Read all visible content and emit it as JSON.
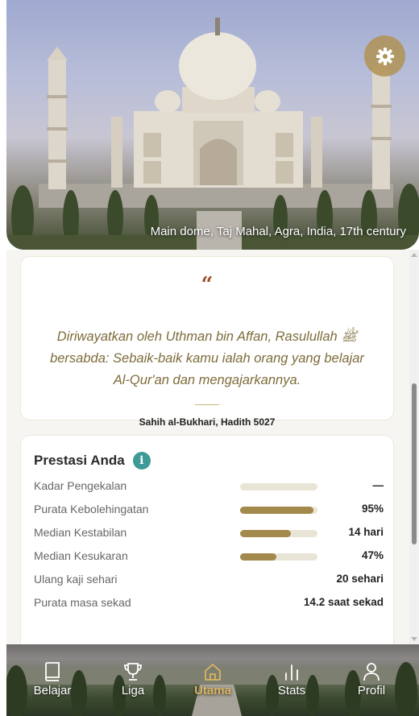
{
  "hero": {
    "caption": "Main dome, Taj Mahal, Agra, India, 17th century",
    "settings_icon": "gear-icon"
  },
  "quote": {
    "mark": "“",
    "text": "Diriwayatkan oleh Uthman bin Affan, Rasulullah ﷺ bersabda: Sebaik-baik kamu ialah orang yang belajar Al-Qur'an dan mengajarkannya.",
    "source": "Sahih al-Bukhari, Hadith 5027"
  },
  "stats": {
    "title": "Prestasi Anda",
    "info_icon": "i",
    "rows": [
      {
        "label": "Kadar Pengekalan",
        "value": "—",
        "bar": 0
      },
      {
        "label": "Purata Kebolehingatan",
        "value": "95%",
        "bar": 0.95
      },
      {
        "label": "Median Kestabilan",
        "value": "14 hari",
        "bar": 0.66
      },
      {
        "label": "Median Kesukaran",
        "value": "47%",
        "bar": 0.47
      },
      {
        "label": "Ulang kaji sehari",
        "value": "20 sehari"
      },
      {
        "label": "Purata masa sekad",
        "value": "14.2 saat sekad"
      }
    ],
    "colors": {
      "bar_fill": "#a38a4c",
      "bar_track": "#e9e5d6"
    }
  },
  "nav": {
    "items": [
      {
        "label": "Belajar",
        "icon": "book-icon"
      },
      {
        "label": "Liga",
        "icon": "trophy-icon"
      },
      {
        "label": "Utama",
        "icon": "home-icon",
        "active": true
      },
      {
        "label": "Stats",
        "icon": "bar-chart-icon"
      },
      {
        "label": "Profil",
        "icon": "user-icon"
      }
    ],
    "active_color": "#d9b65f"
  }
}
